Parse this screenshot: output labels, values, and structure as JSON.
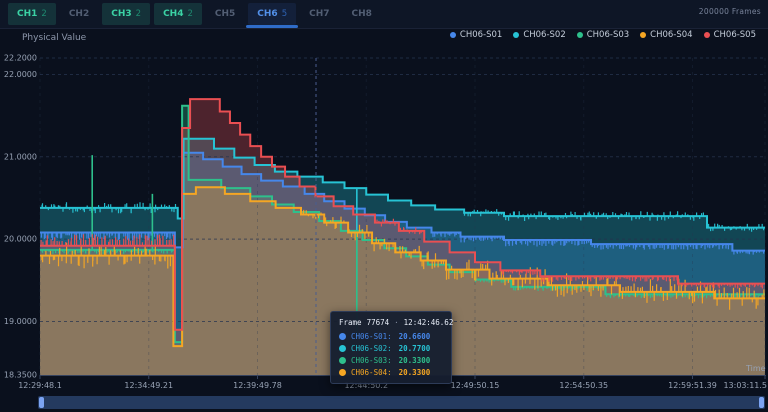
{
  "header": {
    "frame_counter": "200000 Frames",
    "tabs": [
      {
        "label": "CH1",
        "count": "2",
        "state": "green"
      },
      {
        "label": "CH2",
        "count": "",
        "state": "plain"
      },
      {
        "label": "CH3",
        "count": "2",
        "state": "green"
      },
      {
        "label": "CH4",
        "count": "2",
        "state": "green"
      },
      {
        "label": "CH5",
        "count": "",
        "state": "plain"
      },
      {
        "label": "CH6",
        "count": "5",
        "state": "selected"
      },
      {
        "label": "CH7",
        "count": "",
        "state": "plain"
      },
      {
        "label": "CH8",
        "count": "",
        "state": "plain"
      }
    ]
  },
  "chart": {
    "y_axis_title": "Physical Value",
    "x_axis_title": "Time"
  },
  "legend": {
    "items": [
      {
        "label": "CH06-S01",
        "color": "#4687ea"
      },
      {
        "label": "CH06-S02",
        "color": "#27c3d4"
      },
      {
        "label": "CH06-S03",
        "color": "#2ec08c"
      },
      {
        "label": "CH06-S04",
        "color": "#f5a623"
      },
      {
        "label": "CH06-S05",
        "color": "#ea4f52"
      }
    ]
  },
  "tooltip": {
    "frame_label": "Frame",
    "frame_number": "77674",
    "separator": "·",
    "time": "12:42:46.62",
    "rows": [
      {
        "label": "CH06-S01:",
        "value": "20.6600",
        "color": "#4687ea"
      },
      {
        "label": "CH06-S02:",
        "value": "20.7700",
        "color": "#27c3d4"
      },
      {
        "label": "CH06-S03:",
        "value": "20.3300",
        "color": "#2ec08c"
      },
      {
        "label": "CH06-S04:",
        "value": "20.3300",
        "color": "#f5a623"
      }
    ]
  },
  "colors": {
    "background": "#0a101d",
    "tabbar_bg": "#0e1626",
    "tab_green_bg": "#143239",
    "tab_green_text": "#3bd3a5",
    "tab_selected_text": "#5290e8",
    "tab_underline": "#2f6cc8",
    "grid": "#27344f",
    "axis": "#36435f",
    "tick_text": "#97a2b4",
    "scroll_track": "#243a5f",
    "scroll_handle": "#7ba3f2"
  },
  "chart_data": {
    "type": "line",
    "step": true,
    "title": "",
    "xlabel": "Time",
    "ylabel": "Physical Value",
    "ylim": [
      18.35,
      22.2
    ],
    "grid": true,
    "legend_position": "top-right",
    "crosshair_f": 0.3807,
    "y_ticks": [
      {
        "v": 22.2,
        "label": "22.2000"
      },
      {
        "v": 22.0,
        "label": "22.0000"
      },
      {
        "v": 21.0,
        "label": "21.0000"
      },
      {
        "v": 20.0,
        "label": "20.0000"
      },
      {
        "v": 19.0,
        "label": "19.0000"
      },
      {
        "v": 18.35,
        "label": "18.3500"
      }
    ],
    "x_ticks": [
      {
        "f": 0.0,
        "label": "12:29:48.1"
      },
      {
        "f": 0.15,
        "label": "12:34:49.21"
      },
      {
        "f": 0.3,
        "label": "12:39:49.78"
      },
      {
        "f": 0.45,
        "label": "12:44:50.2"
      },
      {
        "f": 0.6,
        "label": "12:49:50.15"
      },
      {
        "f": 0.75,
        "label": "12:54:50.35"
      },
      {
        "f": 0.9,
        "label": "12:59:51.39"
      },
      {
        "f": 1.0,
        "label": "13:03:11.5"
      }
    ],
    "series": [
      {
        "name": "CH06-S01",
        "color": "#4687ea",
        "segments": [
          [
            0.0,
            0.186,
            20.08,
            0.1,
            -1
          ],
          [
            0.186,
            0.197,
            19.9,
            0,
            0
          ],
          [
            0.197,
            0.225,
            21.05,
            0,
            0
          ],
          [
            0.225,
            0.252,
            20.97,
            0,
            0
          ],
          [
            0.252,
            0.278,
            20.88,
            0,
            0
          ],
          [
            0.278,
            0.305,
            20.79,
            0,
            0
          ],
          [
            0.305,
            0.335,
            20.71,
            0,
            0
          ],
          [
            0.335,
            0.365,
            20.64,
            0,
            0
          ],
          [
            0.365,
            0.392,
            20.55,
            0,
            0
          ],
          [
            0.392,
            0.42,
            20.46,
            0,
            0
          ],
          [
            0.42,
            0.448,
            20.37,
            0,
            0
          ],
          [
            0.448,
            0.476,
            20.29,
            0,
            0
          ],
          [
            0.476,
            0.506,
            20.21,
            0,
            0
          ],
          [
            0.506,
            0.54,
            20.14,
            0,
            0
          ],
          [
            0.54,
            0.58,
            20.08,
            0.06,
            -1
          ],
          [
            0.58,
            0.64,
            20.03,
            0.07,
            -1
          ],
          [
            0.64,
            0.76,
            19.99,
            0.08,
            -1
          ],
          [
            0.76,
            0.955,
            19.94,
            0.07,
            -1
          ],
          [
            0.955,
            1.0,
            19.86,
            0.05,
            -1
          ]
        ],
        "spikes": []
      },
      {
        "name": "CH06-S02",
        "color": "#27c3d4",
        "segments": [
          [
            0.0,
            0.19,
            20.38,
            0.07,
            0
          ],
          [
            0.19,
            0.198,
            20.25,
            0,
            0
          ],
          [
            0.198,
            0.24,
            21.22,
            0,
            0
          ],
          [
            0.24,
            0.268,
            21.1,
            0,
            0
          ],
          [
            0.268,
            0.296,
            20.99,
            0,
            0
          ],
          [
            0.296,
            0.324,
            20.9,
            0,
            0
          ],
          [
            0.324,
            0.355,
            20.82,
            0,
            0
          ],
          [
            0.355,
            0.39,
            20.76,
            0,
            0
          ],
          [
            0.39,
            0.42,
            20.69,
            0,
            0
          ],
          [
            0.42,
            0.45,
            20.62,
            0,
            0
          ],
          [
            0.45,
            0.48,
            20.54,
            0,
            0
          ],
          [
            0.48,
            0.512,
            20.47,
            0,
            0
          ],
          [
            0.512,
            0.545,
            20.41,
            0,
            0
          ],
          [
            0.545,
            0.585,
            20.36,
            0,
            0
          ],
          [
            0.585,
            0.64,
            20.32,
            0.05,
            0
          ],
          [
            0.64,
            0.92,
            20.28,
            0.06,
            0
          ],
          [
            0.92,
            1.0,
            20.14,
            0.05,
            0
          ]
        ],
        "spikes": [
          [
            0.437,
            19.5
          ]
        ]
      },
      {
        "name": "CH06-S03",
        "color": "#2ec08c",
        "segments": [
          [
            0.0,
            0.186,
            19.87,
            0.05,
            -1
          ],
          [
            0.186,
            0.196,
            18.75,
            0,
            0
          ],
          [
            0.196,
            0.205,
            21.62,
            0,
            0
          ],
          [
            0.205,
            0.25,
            20.72,
            0,
            0
          ],
          [
            0.25,
            0.29,
            20.62,
            0,
            0
          ],
          [
            0.29,
            0.32,
            20.52,
            0,
            0
          ],
          [
            0.32,
            0.35,
            20.42,
            0,
            0
          ],
          [
            0.35,
            0.385,
            20.33,
            0,
            0
          ],
          [
            0.385,
            0.415,
            20.22,
            0,
            0
          ],
          [
            0.415,
            0.445,
            20.1,
            0,
            0
          ],
          [
            0.445,
            0.475,
            19.99,
            0,
            0
          ],
          [
            0.475,
            0.505,
            19.89,
            0,
            0
          ],
          [
            0.505,
            0.535,
            19.79,
            0,
            0
          ],
          [
            0.535,
            0.565,
            19.69,
            0,
            0
          ],
          [
            0.565,
            0.6,
            19.6,
            0,
            0
          ],
          [
            0.6,
            0.65,
            19.51,
            0.04,
            -1
          ],
          [
            0.65,
            0.78,
            19.42,
            0.05,
            -1
          ],
          [
            0.78,
            1.0,
            19.33,
            0.05,
            -1
          ]
        ],
        "spikes": [
          [
            0.072,
            21.02
          ],
          [
            0.155,
            20.55
          ],
          [
            0.437,
            18.8
          ]
        ]
      },
      {
        "name": "CH06-S04",
        "color": "#f5a623",
        "segments": [
          [
            0.0,
            0.184,
            19.8,
            0.16,
            0
          ],
          [
            0.184,
            0.196,
            18.7,
            0,
            0
          ],
          [
            0.196,
            0.215,
            20.55,
            0,
            0
          ],
          [
            0.215,
            0.255,
            20.63,
            0,
            0
          ],
          [
            0.255,
            0.29,
            20.55,
            0,
            0
          ],
          [
            0.29,
            0.325,
            20.46,
            0,
            0
          ],
          [
            0.325,
            0.36,
            20.38,
            0,
            0
          ],
          [
            0.36,
            0.392,
            20.3,
            0.06,
            0
          ],
          [
            0.392,
            0.425,
            20.2,
            0.08,
            0
          ],
          [
            0.425,
            0.458,
            20.08,
            0.1,
            0
          ],
          [
            0.458,
            0.49,
            19.95,
            0.1,
            0
          ],
          [
            0.49,
            0.525,
            19.84,
            0.1,
            0
          ],
          [
            0.525,
            0.56,
            19.74,
            0.12,
            0
          ],
          [
            0.56,
            0.62,
            19.63,
            0.14,
            0
          ],
          [
            0.62,
            0.7,
            19.52,
            0.14,
            0
          ],
          [
            0.7,
            0.8,
            19.44,
            0.15,
            0
          ],
          [
            0.8,
            0.93,
            19.36,
            0.16,
            0
          ],
          [
            0.93,
            1.0,
            19.28,
            0.14,
            0
          ]
        ],
        "spikes": []
      },
      {
        "name": "CH06-S05",
        "color": "#ea4f52",
        "segments": [
          [
            0.0,
            0.186,
            19.92,
            0.14,
            1
          ],
          [
            0.186,
            0.196,
            18.9,
            0,
            0
          ],
          [
            0.196,
            0.207,
            21.35,
            0,
            0
          ],
          [
            0.207,
            0.248,
            21.7,
            0,
            0
          ],
          [
            0.248,
            0.262,
            21.55,
            0,
            0
          ],
          [
            0.262,
            0.276,
            21.41,
            0,
            0
          ],
          [
            0.276,
            0.29,
            21.27,
            0,
            0
          ],
          [
            0.29,
            0.305,
            21.13,
            0,
            0
          ],
          [
            0.305,
            0.32,
            21.0,
            0,
            0
          ],
          [
            0.32,
            0.338,
            20.88,
            0,
            0
          ],
          [
            0.338,
            0.358,
            20.76,
            0,
            0
          ],
          [
            0.358,
            0.38,
            20.64,
            0,
            0
          ],
          [
            0.38,
            0.405,
            20.52,
            0,
            0
          ],
          [
            0.405,
            0.432,
            20.4,
            0,
            0
          ],
          [
            0.432,
            0.462,
            20.3,
            0,
            0
          ],
          [
            0.462,
            0.495,
            20.2,
            0.05,
            0
          ],
          [
            0.495,
            0.53,
            20.1,
            0.05,
            0
          ],
          [
            0.53,
            0.565,
            19.97,
            0,
            0
          ],
          [
            0.565,
            0.6,
            19.84,
            0,
            0
          ],
          [
            0.6,
            0.635,
            19.72,
            0,
            0
          ],
          [
            0.635,
            0.69,
            19.62,
            0.06,
            -1
          ],
          [
            0.69,
            0.88,
            19.55,
            0.07,
            -1
          ],
          [
            0.88,
            1.0,
            19.46,
            0.06,
            -1
          ]
        ],
        "spikes": []
      }
    ]
  }
}
